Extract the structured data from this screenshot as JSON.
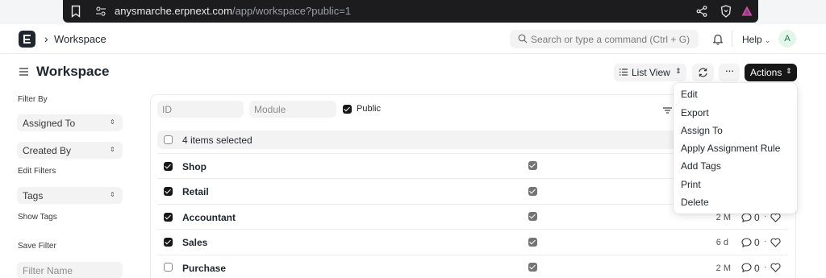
{
  "browser": {
    "url_host": "anysmarche.erpnext.com",
    "url_path": "/app/workspace?public=1"
  },
  "navbar": {
    "breadcrumb": "Workspace",
    "search_placeholder": "Search or type a command (Ctrl + G)",
    "help_label": "Help",
    "avatar_initial": "A"
  },
  "page": {
    "title": "Workspace",
    "list_view_label": "List View",
    "actions_label": "Actions",
    "more_label": "···"
  },
  "sidebar": {
    "filter_by": "Filter By",
    "assigned_to": "Assigned To",
    "created_by": "Created By",
    "edit_filters": "Edit Filters",
    "tags": "Tags",
    "show_tags": "Show Tags",
    "save_filter": "Save Filter",
    "filter_name_placeholder": "Filter Name"
  },
  "list": {
    "filters": {
      "id_placeholder": "ID",
      "module_placeholder": "Module",
      "public_label": "Public",
      "public_checked": true
    },
    "selection_text": "4 items selected",
    "rows": [
      {
        "title": "Shop",
        "selected": true,
        "public": true,
        "modified": "",
        "comments": ""
      },
      {
        "title": "Retail",
        "selected": true,
        "public": true,
        "modified": "",
        "comments": ""
      },
      {
        "title": "Accountant",
        "selected": true,
        "public": true,
        "modified": "2 M",
        "comments": "0"
      },
      {
        "title": "Sales",
        "selected": true,
        "public": true,
        "modified": "6 d",
        "comments": "0"
      },
      {
        "title": "Purchase",
        "selected": false,
        "public": true,
        "modified": "2 M",
        "comments": "0"
      }
    ]
  },
  "actions_menu": {
    "items": [
      "Edit",
      "Export",
      "Assign To",
      "Apply Assignment Rule",
      "Add Tags",
      "Print",
      "Delete"
    ]
  },
  "colors": {
    "primary_dark": "#171717",
    "control_bg": "#f3f3f3",
    "avatar_bg": "#e4f5e9",
    "avatar_fg": "#16794c"
  }
}
